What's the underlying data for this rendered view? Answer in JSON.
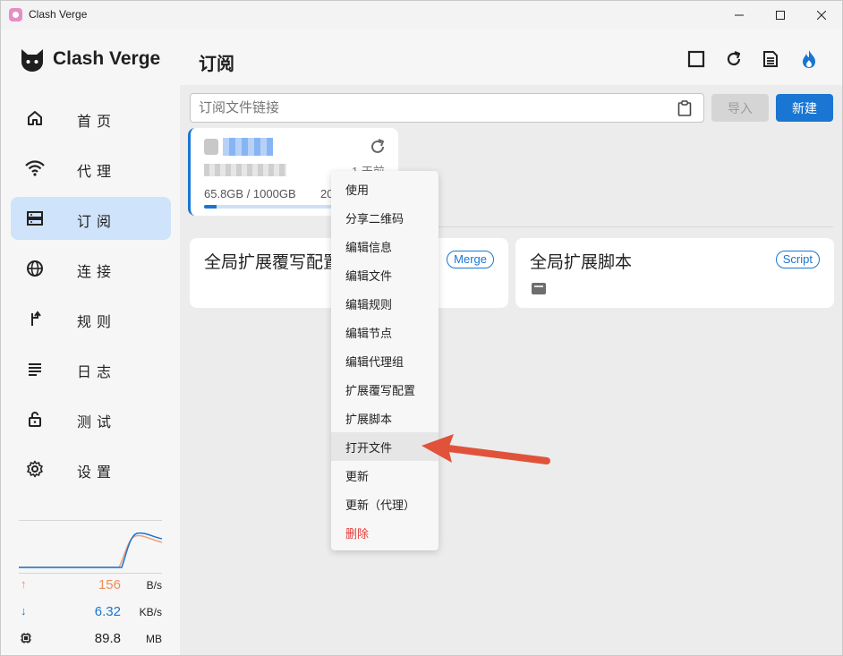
{
  "window": {
    "title": "Clash Verge",
    "minimize": "—",
    "maximize": "☐",
    "close": "✕"
  },
  "sidebar": {
    "logo_text": "Clash Verge",
    "items": [
      {
        "label": "首页",
        "icon": "home-icon"
      },
      {
        "label": "代理",
        "icon": "wifi-icon"
      },
      {
        "label": "订阅",
        "icon": "server-icon",
        "active": true
      },
      {
        "label": "连接",
        "icon": "globe-icon"
      },
      {
        "label": "规则",
        "icon": "fork-icon"
      },
      {
        "label": "日志",
        "icon": "list-icon"
      },
      {
        "label": "测试",
        "icon": "lock-icon"
      },
      {
        "label": "设置",
        "icon": "gear-icon"
      }
    ],
    "stats": {
      "upload": {
        "value": "156",
        "unit": "B/s",
        "color": "#f08c5a"
      },
      "download": {
        "value": "6.32",
        "unit": "KB/s",
        "color": "#1976d2"
      },
      "memory": {
        "value": "89.8",
        "unit": "MB"
      }
    }
  },
  "header": {
    "title": "订阅"
  },
  "toolbar": {
    "url_placeholder": "订阅文件链接",
    "import_label": "导入",
    "new_label": "新建"
  },
  "profile_card": {
    "updated": "1 天前",
    "usage": "65.8GB / 1000GB",
    "expire": "20",
    "usage_fraction": 0.066
  },
  "extensions": {
    "merge": {
      "title": "全局扩展覆写配置",
      "badge": "Merge"
    },
    "script": {
      "title": "全局扩展脚本",
      "badge": "Script"
    }
  },
  "context_menu": {
    "items": [
      "使用",
      "分享二维码",
      "编辑信息",
      "编辑文件",
      "编辑规则",
      "编辑节点",
      "编辑代理组",
      "扩展覆写配置",
      "扩展脚本",
      "打开文件",
      "更新",
      "更新（代理）",
      "删除"
    ]
  },
  "colors": {
    "accent": "#1976d2",
    "active_nav": "#cfe3fb",
    "arrow": "#e0533a",
    "danger": "#e53935"
  }
}
